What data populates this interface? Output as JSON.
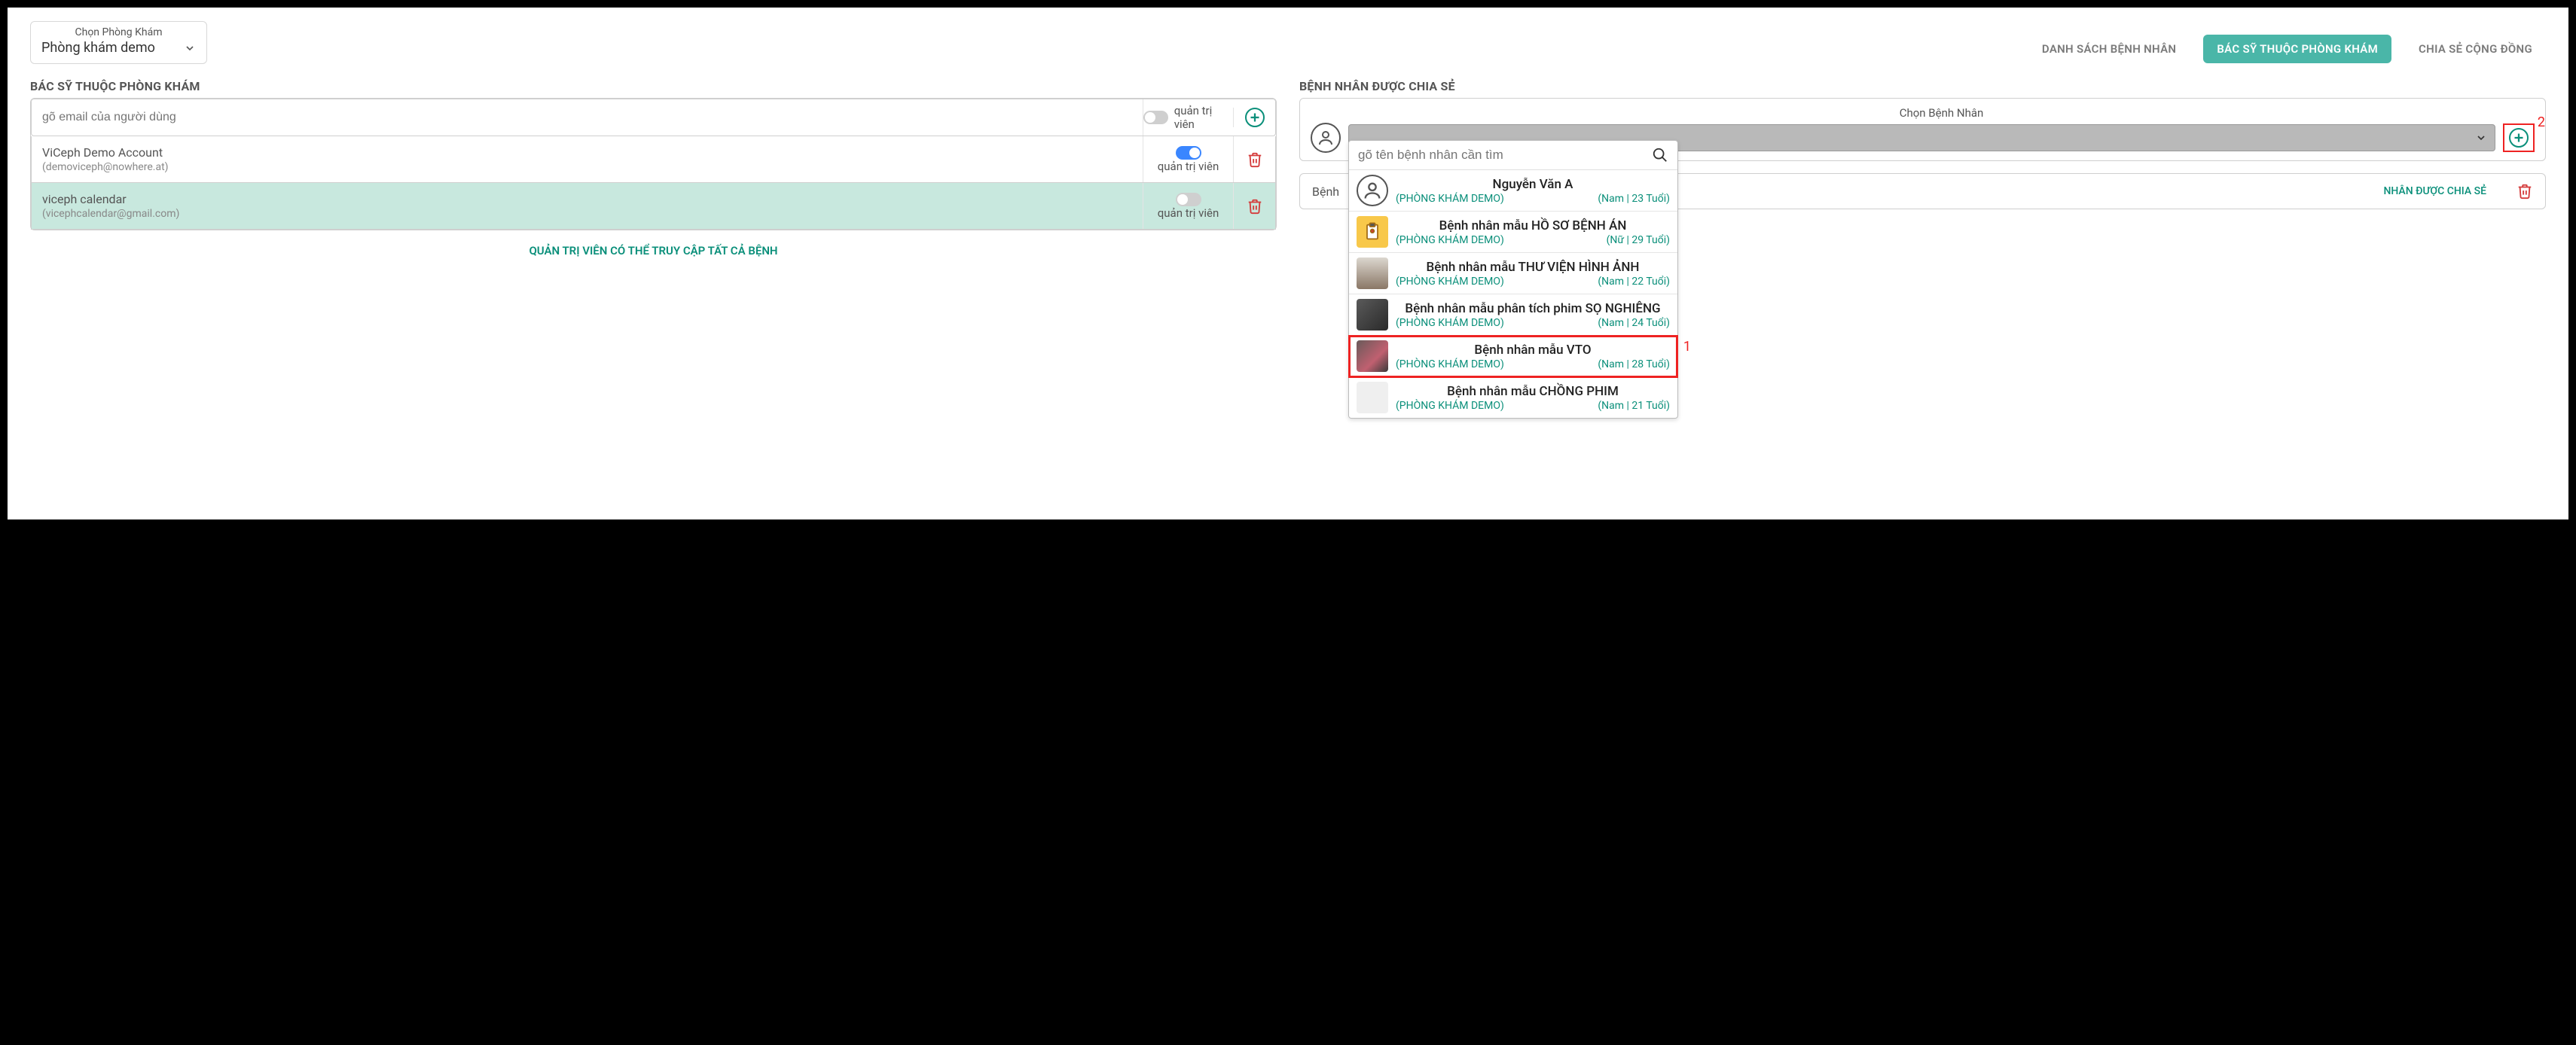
{
  "clinic_selector": {
    "label": "Chọn Phòng Khám",
    "value": "Phòng khám demo"
  },
  "nav": {
    "items": [
      "DANH SÁCH BỆNH NHÂN",
      "BÁC SỸ THUỘC PHÒNG KHÁM",
      "CHIA SẺ CỘNG ĐỒNG"
    ],
    "active_index": 1
  },
  "left": {
    "title": "BÁC SỸ THUỘC PHÒNG KHÁM",
    "email_placeholder": "gõ email của người dùng",
    "admin_label": "quản trị viên",
    "doctors": [
      {
        "name": "ViCeph Demo Account",
        "email": "(demoviceph@nowhere.at)",
        "admin_on": true,
        "selected": false
      },
      {
        "name": "viceph calendar",
        "email": "(vicephcalendar@gmail.com)",
        "admin_on": false,
        "selected": true
      }
    ],
    "footer_prefix": "QUẢN TRỊ VIÊN CÓ THỂ TRUY CẬP TẤT CẢ BỆNH "
  },
  "right": {
    "title": "BỆNH NHÂN ĐƯỢC CHIA SẺ",
    "select_label": "Chọn Bệnh Nhân",
    "search_placeholder": "gõ tên bệnh nhân cần tìm",
    "options": [
      {
        "name": "Nguyễn Văn A",
        "clinic": "(PHÒNG KHÁM DEMO)",
        "meta": "(Nam  |  23 Tuổi)",
        "thumb": "person-icon",
        "highlight": false
      },
      {
        "name": "Bệnh nhân mẫu HỒ SƠ BỆNH ÁN",
        "clinic": "(PHÒNG KHÁM DEMO)",
        "meta": "(Nữ  |  29 Tuổi)",
        "thumb": "clipboard",
        "highlight": false
      },
      {
        "name": "Bệnh nhân mẫu THƯ VIỆN HÌNH ẢNH",
        "clinic": "(PHÒNG KHÁM DEMO)",
        "meta": "(Nam  |  22 Tuổi)",
        "thumb": "photo1",
        "highlight": false
      },
      {
        "name": "Bệnh nhân mẫu phân tích phim SỌ NGHIÊNG",
        "clinic": "(PHÒNG KHÁM DEMO)",
        "meta": "(Nam  |  24 Tuổi)",
        "thumb": "xray",
        "highlight": false
      },
      {
        "name": "Bệnh nhân mẫu VTO",
        "clinic": "(PHÒNG KHÁM DEMO)",
        "meta": "(Nam  |  28 Tuổi)",
        "thumb": "xray2",
        "highlight": true
      },
      {
        "name": "Bệnh nhân mẫu CHỒNG PHIM",
        "clinic": "(PHÒNG KHÁM DEMO)",
        "meta": "(Nam  |  21 Tuổi)",
        "thumb": "sketch",
        "highlight": false
      }
    ],
    "strip_label": "Bệnh",
    "strip_link_suffix": "NHÂN ĐƯỢC CHIA SẺ",
    "annotation_1": "1",
    "annotation_2": "2"
  }
}
